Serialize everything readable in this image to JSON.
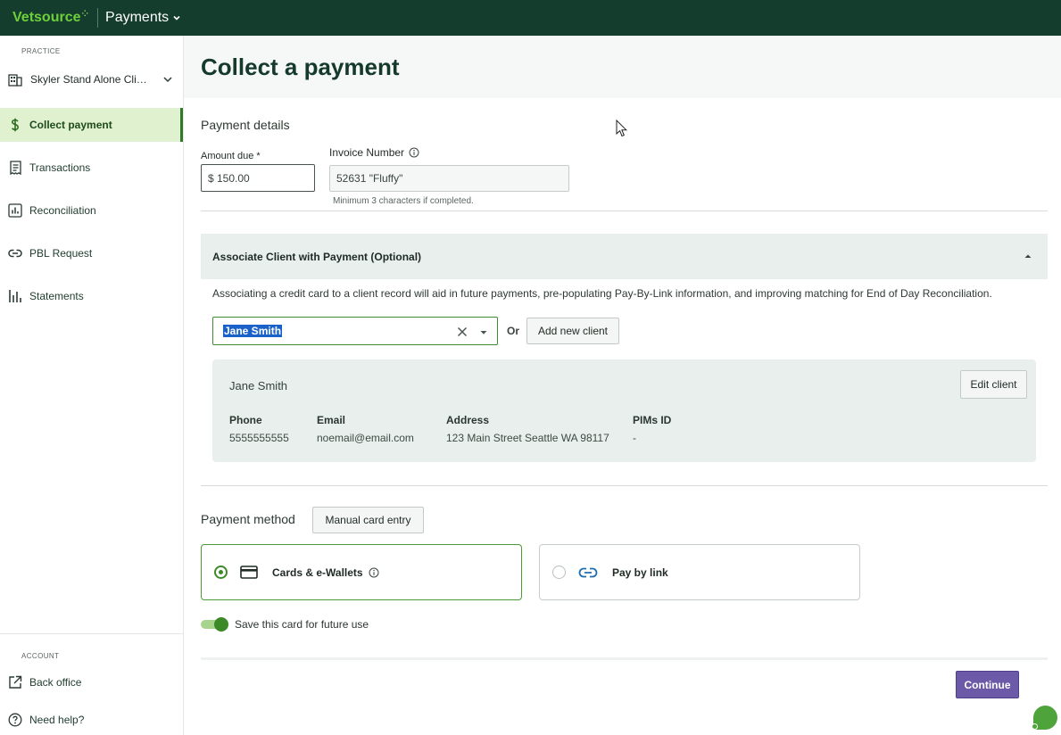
{
  "topbar": {
    "brand": "Vetsource",
    "app_name": "Payments"
  },
  "sidebar": {
    "practice_label": "PRACTICE",
    "practice_name": "Skyler Stand Alone Cli…",
    "items": [
      {
        "label": "Collect payment",
        "icon": "dollar-icon",
        "active": true
      },
      {
        "label": "Transactions",
        "icon": "receipt-icon"
      },
      {
        "label": "Reconciliation",
        "icon": "chart-box-icon"
      },
      {
        "label": "PBL Request",
        "icon": "link-icon"
      },
      {
        "label": "Statements",
        "icon": "bar-chart-icon"
      }
    ],
    "account_label": "ACCOUNT",
    "account_items": [
      {
        "label": "Back office",
        "icon": "external-link-icon"
      },
      {
        "label": "Need help?",
        "icon": "help-icon"
      }
    ]
  },
  "page": {
    "title": "Collect a payment"
  },
  "payment_details": {
    "title": "Payment details",
    "amount_label": "Amount due *",
    "amount_value": "$ 150.00",
    "invoice_label": "Invoice Number",
    "invoice_value": "52631 \"Fluffy\"",
    "invoice_hint": "Minimum 3 characters if completed."
  },
  "associate": {
    "title": "Associate Client with Payment (Optional)",
    "description": "Associating a credit card to a client record will aid in future payments, pre-populating Pay-By-Link information, and improving matching for End of Day Reconciliation.",
    "client_selected": "Jane Smith",
    "or_label": "Or",
    "add_client_label": "Add new client"
  },
  "client": {
    "name": "Jane Smith",
    "edit_label": "Edit client",
    "fields": [
      {
        "key": "Phone",
        "value": "5555555555"
      },
      {
        "key": "Email",
        "value": "noemail@email.com"
      },
      {
        "key": "Address",
        "value": "123 Main Street Seattle WA 98117"
      },
      {
        "key": "PIMs ID",
        "value": "-"
      }
    ]
  },
  "payment_method": {
    "label": "Payment method",
    "manual_entry_label": "Manual card entry",
    "options": [
      {
        "label": "Cards & e-Wallets",
        "selected": true
      },
      {
        "label": "Pay by link",
        "selected": false
      }
    ],
    "save_card_label": "Save this card for future use",
    "save_card_on": true
  },
  "footer": {
    "continue_label": "Continue"
  },
  "colors": {
    "brand_dark": "#143d2e",
    "accent_green": "#3e8a2a",
    "continue_purple": "#6c5aa8"
  }
}
